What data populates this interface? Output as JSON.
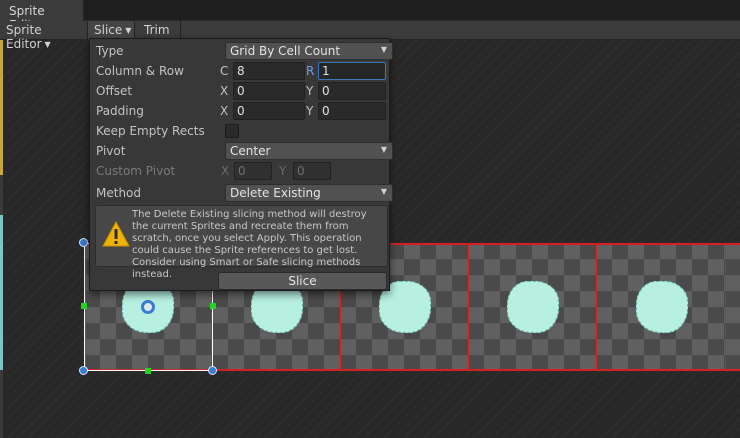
{
  "window": {
    "title": "Sprite Editor"
  },
  "toolbar": {
    "sprite_editor": "Sprite Editor",
    "slice": "Slice",
    "trim": "Trim"
  },
  "slice_popup": {
    "type": {
      "label": "Type",
      "value": "Grid By Cell Count"
    },
    "column_row": {
      "label": "Column & Row",
      "c_label": "C",
      "c_value": "8",
      "r_label": "R",
      "r_value": "1"
    },
    "offset": {
      "label": "Offset",
      "x_label": "X",
      "x_value": "0",
      "y_label": "Y",
      "y_value": "0"
    },
    "padding": {
      "label": "Padding",
      "x_label": "X",
      "x_value": "0",
      "y_label": "Y",
      "y_value": "0"
    },
    "keep_empty_rects": {
      "label": "Keep Empty Rects",
      "checked": false
    },
    "pivot": {
      "label": "Pivot",
      "value": "Center"
    },
    "custom_pivot": {
      "label": "Custom Pivot",
      "x_label": "X",
      "x_value": "0",
      "y_label": "Y",
      "y_value": "0"
    },
    "method": {
      "label": "Method",
      "value": "Delete Existing"
    },
    "help": "The Delete Existing slicing method will destroy the current Sprites and recreate them from scratch, once you select Apply. This operation could cause the Sprite references to get lost. Consider using Smart or Safe slicing methods instead.",
    "slice_button": "Slice"
  },
  "icons": {
    "dropdown": "chevron-down-icon",
    "warning": "warning-icon"
  },
  "colors": {
    "accent_blue": "#3a79bb",
    "slice_red": "#d32222",
    "handle_green": "#22d322",
    "sprite_fill": "#b7efe0"
  }
}
